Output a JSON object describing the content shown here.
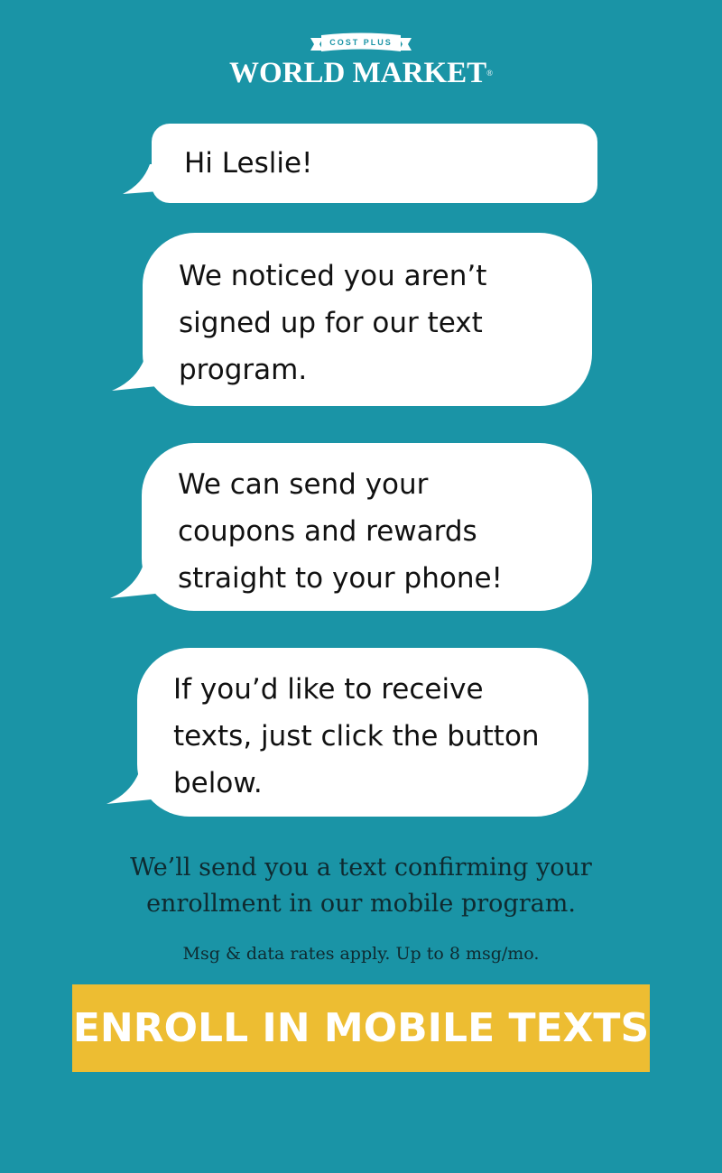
{
  "brand": {
    "banner_text": "COST PLUS",
    "name": "WORLD MARKET",
    "registered_mark": "®"
  },
  "messages": [
    {
      "lines": [
        "Hi Leslie!"
      ]
    },
    {
      "lines": [
        "We noticed you aren’t",
        "signed up for our text",
        "program."
      ]
    },
    {
      "lines": [
        "We can send your",
        "coupons and rewards",
        "straight to your phone!"
      ]
    },
    {
      "lines": [
        "If you’d like to receive",
        "texts, just click the button",
        "below."
      ]
    }
  ],
  "confirmation": {
    "line1": "We’ll send you a text confirming your",
    "line2": "enrollment in our mobile program."
  },
  "disclaimer": "Msg & data rates apply. Up to 8 msg/mo.",
  "cta": {
    "label": "ENROLL IN MOBILE TEXTS"
  },
  "colors": {
    "background": "#1a94a6",
    "bubble": "#ffffff",
    "cta": "#edbd32"
  }
}
